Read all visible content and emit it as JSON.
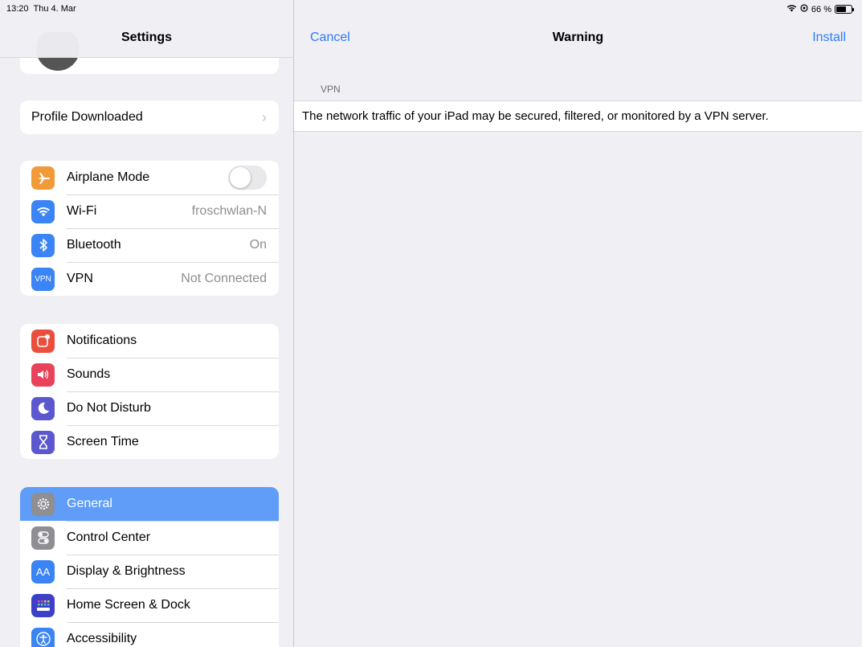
{
  "status_bar": {
    "time": "13:20",
    "date": "Thu 4. Mar",
    "battery": "66 %",
    "battery_level": 0.66,
    "icons": [
      "wifi-icon",
      "vpn-lock-icon",
      "battery-icon"
    ]
  },
  "sidebar": {
    "title": "Settings",
    "profile_row": {
      "label": "Profile Downloaded"
    },
    "connectivity": [
      {
        "label": "Airplane Mode",
        "icon": "airplane-icon",
        "color": "#f29a38",
        "toggle": false
      },
      {
        "label": "Wi-Fi",
        "icon": "wifi-icon",
        "color": "#3a84f5",
        "value": "froschwlan-N"
      },
      {
        "label": "Bluetooth",
        "icon": "bluetooth-icon",
        "color": "#3a84f5",
        "value": "On"
      },
      {
        "label": "VPN",
        "icon": "vpn-icon",
        "icon_text": "VPN",
        "color": "#3a84f5",
        "value": "Not Connected"
      }
    ],
    "alerts": [
      {
        "label": "Notifications",
        "icon": "notifications-icon",
        "color": "#ea4e3d"
      },
      {
        "label": "Sounds",
        "icon": "sounds-icon",
        "color": "#e8435a"
      },
      {
        "label": "Do Not Disturb",
        "icon": "moon-icon",
        "color": "#5b57cf"
      },
      {
        "label": "Screen Time",
        "icon": "hourglass-icon",
        "color": "#5b57cf"
      }
    ],
    "system": [
      {
        "label": "General",
        "icon": "gear-icon",
        "color": "#8e8e93",
        "selected": true
      },
      {
        "label": "Control Center",
        "icon": "control-center-icon",
        "color": "#8e8e93"
      },
      {
        "label": "Display & Brightness",
        "icon": "display-icon",
        "icon_text": "AA",
        "color": "#3a84f5"
      },
      {
        "label": "Home Screen & Dock",
        "icon": "home-screen-icon",
        "color": "#3c3fc8"
      },
      {
        "label": "Accessibility",
        "icon": "accessibility-icon",
        "color": "#3a84f5"
      }
    ]
  },
  "detail": {
    "nav": {
      "cancel": "Cancel",
      "title": "Warning",
      "install": "Install"
    },
    "section_header": "VPN",
    "warning_text": "The network traffic of your iPad may be secured, filtered, or monitored by a VPN server."
  },
  "colors": {
    "accent": "#2f7cf6",
    "selected_row": "#5f9df8",
    "background": "#efeff4"
  }
}
